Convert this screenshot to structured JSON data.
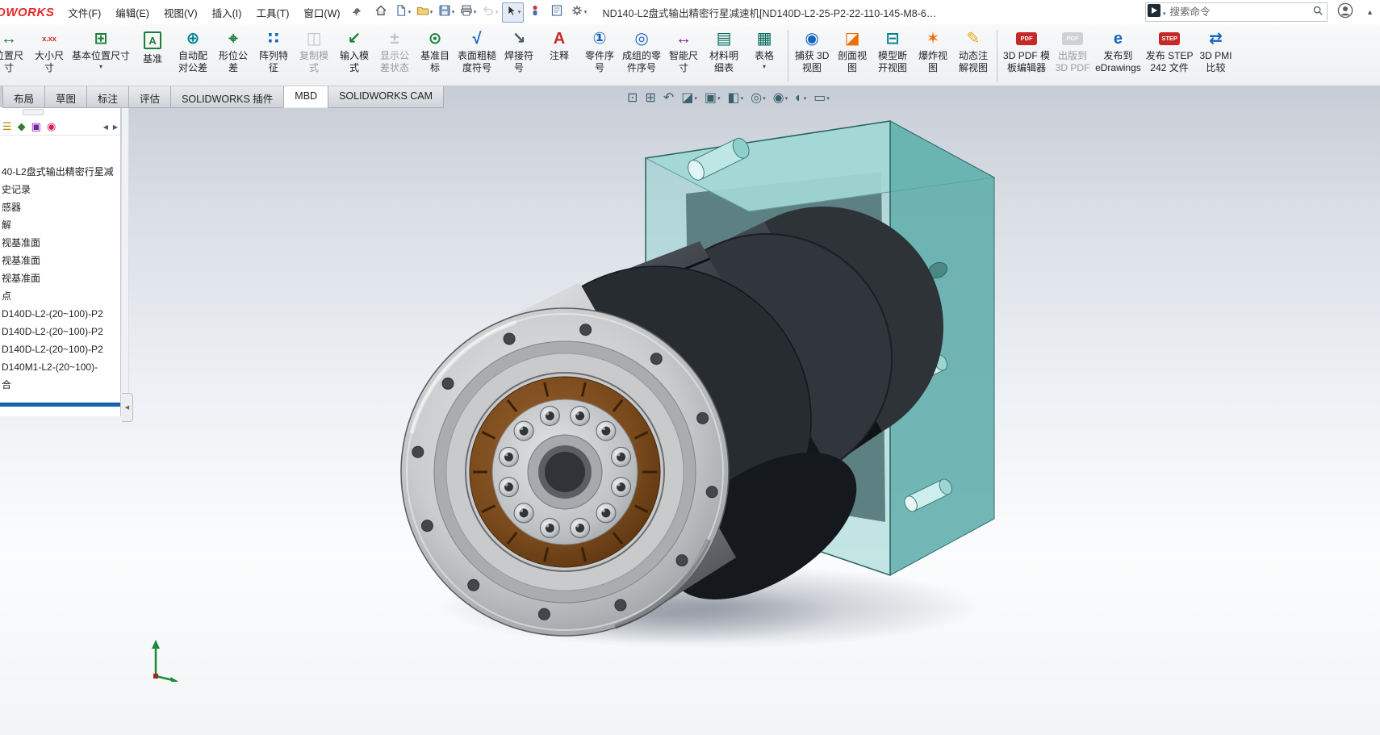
{
  "window": {
    "logo": "DWORKS",
    "title": "ND140-L2盘式输出精密行星减速机[ND140D-L2-25-P2-22-110-145-M8-6…"
  },
  "menubar": {
    "items": [
      "文件(F)",
      "编辑(E)",
      "视图(V)",
      "插入(I)",
      "工具(T)",
      "窗口(W)"
    ]
  },
  "quickbar": [
    {
      "name": "home",
      "dd": false
    },
    {
      "name": "new-document",
      "dd": true
    },
    {
      "name": "open",
      "dd": true
    },
    {
      "name": "save",
      "dd": true
    },
    {
      "name": "print",
      "dd": true
    },
    {
      "name": "undo",
      "dd": true,
      "disabled": true
    },
    {
      "name": "select",
      "dd": true,
      "pressed": true
    },
    {
      "name": "rebuild",
      "dd": false
    },
    {
      "name": "file-properties",
      "dd": false
    },
    {
      "name": "options",
      "dd": true
    }
  ],
  "search": {
    "placeholder": "搜索命令"
  },
  "ribbon": {
    "buttons": [
      {
        "name": "position-dimension",
        "lines": [
          "位置尺",
          "寸"
        ],
        "icon": {
          "g": "↔",
          "c": "#1a7f37"
        }
      },
      {
        "name": "size-dimension",
        "lines": [
          "大小尺",
          "寸"
        ],
        "icon": {
          "g": "x.xx",
          "c": "#c62828"
        }
      },
      {
        "name": "basic-location-dimension",
        "lines": [
          "基本位置尺寸"
        ],
        "dd": true,
        "icon": {
          "g": "⊞",
          "c": "#1a7f37"
        }
      },
      {
        "name": "datum",
        "lines": [
          "基准"
        ],
        "icon": {
          "g": "A",
          "c": "#1a7f37",
          "box": true
        }
      },
      {
        "name": "auto-pair-tolerance",
        "lines": [
          "自动配",
          "对公差"
        ],
        "icon": {
          "g": "⊕",
          "c": "#00838f"
        }
      },
      {
        "name": "geometric-tolerance",
        "lines": [
          "形位公",
          "差"
        ],
        "icon": {
          "g": "⌖",
          "c": "#1a7f37"
        }
      },
      {
        "name": "pattern-feature",
        "lines": [
          "阵列特",
          "征"
        ],
        "icon": {
          "g": "∷",
          "c": "#1565c0"
        }
      },
      {
        "name": "copy-scheme",
        "lines": [
          "复制模",
          "式"
        ],
        "disabled": true,
        "icon": {
          "g": "◫",
          "c": "#7a8087"
        }
      },
      {
        "name": "import-scheme",
        "lines": [
          "输入模",
          "式"
        ],
        "icon": {
          "g": "↙",
          "c": "#1a7f37"
        }
      },
      {
        "name": "show-tolerance-status",
        "lines": [
          "显示公",
          "差状态"
        ],
        "disabled": true,
        "icon": {
          "g": "±",
          "c": "#7a8087"
        }
      },
      {
        "name": "datum-target",
        "lines": [
          "基准目",
          "标"
        ],
        "icon": {
          "g": "⊙",
          "c": "#1a7f37"
        }
      },
      {
        "name": "surface-finish",
        "lines": [
          "表面粗糙",
          "度符号"
        ],
        "icon": {
          "g": "√",
          "c": "#1565c0"
        }
      },
      {
        "name": "weld-symbol",
        "lines": [
          "焊接符",
          "号"
        ],
        "icon": {
          "g": "↘",
          "c": "#455a64"
        }
      },
      {
        "name": "note",
        "lines": [
          "注释"
        ],
        "icon": {
          "g": "A",
          "c": "#c62828"
        }
      },
      {
        "name": "balloon",
        "lines": [
          "零件序",
          "号"
        ],
        "icon": {
          "g": "①",
          "c": "#1565c0"
        }
      },
      {
        "name": "stacked-balloon",
        "lines": [
          "成组的零",
          "件序号"
        ],
        "icon": {
          "g": "◎",
          "c": "#1565c0"
        }
      },
      {
        "name": "smart-dimension",
        "lines": [
          "智能尺",
          "寸"
        ],
        "icon": {
          "g": "↔",
          "c": "#7b1fa2"
        }
      },
      {
        "name": "bill-of-materials",
        "lines": [
          "材料明",
          "细表"
        ],
        "icon": {
          "g": "▤",
          "c": "#00695c"
        }
      },
      {
        "name": "tables",
        "lines": [
          "表格"
        ],
        "dd": true,
        "icon": {
          "g": "▦",
          "c": "#00695c"
        }
      },
      {
        "name": "capture-3d-view",
        "sep": true,
        "lines": [
          "捕获 3D",
          "视图"
        ],
        "icon": {
          "g": "◉",
          "c": "#1565c0"
        }
      },
      {
        "name": "section-view-cmd",
        "lines": [
          "剖面视",
          "图"
        ],
        "icon": {
          "g": "◪",
          "c": "#ef6c00"
        }
      },
      {
        "name": "break-view",
        "lines": [
          "模型断",
          "开视图"
        ],
        "icon": {
          "g": "⊟",
          "c": "#00838f"
        }
      },
      {
        "name": "exploded-view",
        "lines": [
          "爆炸视",
          "图"
        ],
        "icon": {
          "g": "✶",
          "c": "#ef6c00"
        }
      },
      {
        "name": "dynamic-annotation-views",
        "lines": [
          "动态注",
          "解视图"
        ],
        "icon": {
          "g": "✎",
          "c": "#e6a817"
        }
      },
      {
        "name": "3d-pdf-template-editor",
        "sep": true,
        "lines": [
          "3D PDF 模",
          "板编辑器"
        ],
        "icon": {
          "g": "PDF",
          "c": "#ffffff",
          "bg": "#c62828"
        }
      },
      {
        "name": "publish-to-3d-pdf",
        "lines": [
          "出版到",
          "3D PDF"
        ],
        "disabled": true,
        "icon": {
          "g": "PDF",
          "c": "#ffffff",
          "bg": "#9aa0a5"
        }
      },
      {
        "name": "publish-edrawings",
        "lines": [
          "发布到",
          "eDrawings"
        ],
        "icon": {
          "g": "e",
          "c": "#1565c0"
        }
      },
      {
        "name": "publish-step-242",
        "lines": [
          "发布 STEP",
          "242 文件"
        ],
        "icon": {
          "g": "STEP",
          "c": "#ffffff",
          "bg": "#c62828"
        }
      },
      {
        "name": "3d-pmi-compare",
        "lines": [
          "3D PMI",
          "比较"
        ],
        "icon": {
          "g": "⇄",
          "c": "#1565c0"
        }
      }
    ]
  },
  "tabs": {
    "items": [
      {
        "label": "布局",
        "name": "tab-layout"
      },
      {
        "label": "草图",
        "name": "tab-sketch"
      },
      {
        "label": "标注",
        "name": "tab-annotation"
      },
      {
        "label": "评估",
        "name": "tab-evaluate"
      },
      {
        "label": "SOLIDWORKS 插件",
        "name": "tab-solidworks-addins"
      },
      {
        "label": "MBD",
        "name": "tab-mbd",
        "active": true
      },
      {
        "label": "SOLIDWORKS CAM",
        "name": "tab-solidworks-cam"
      }
    ]
  },
  "headsup": {
    "items": [
      {
        "name": "zoom-to-fit",
        "g": "⊡"
      },
      {
        "name": "zoom-to-area",
        "g": "⊞"
      },
      {
        "name": "previous-view",
        "g": "↶"
      },
      {
        "name": "section-view",
        "g": "◪",
        "dd": true
      },
      {
        "name": "view-orientation",
        "g": "▣",
        "dd": true
      },
      {
        "name": "display-style",
        "g": "◧",
        "dd": true
      },
      {
        "name": "hide-show-items",
        "g": "◎",
        "dd": true
      },
      {
        "name": "edit-appearance",
        "g": "◉",
        "dd": true
      },
      {
        "name": "apply-scene",
        "g": "◐",
        "dd": true
      },
      {
        "name": "view-settings",
        "g": "▭",
        "dd": true
      }
    ]
  },
  "panel": {
    "manager_tabs": [
      {
        "name": "featuremanager-tab",
        "g": "☰",
        "c": "#b58900"
      },
      {
        "name": "propertymanager-tab",
        "g": "◆",
        "c": "#2e7d32"
      },
      {
        "name": "configurationmanager-tab",
        "g": "▣",
        "c": "#7b1fa2"
      },
      {
        "name": "displaymanager-tab",
        "g": "◉",
        "c": "#d81b60"
      }
    ],
    "tree": [
      "40-L2盘式输出精密行星减",
      "史记录",
      "感器",
      "解",
      "视基准面",
      "视基准面",
      "视基准面",
      "点",
      "D140D-L2-(20~100)-P2",
      "D140D-L2-(20~100)-P2",
      "D140D-L2-(20~100)-P2",
      "D140M1-L2-(20~100)-",
      "合"
    ]
  },
  "colors": {
    "accent_teal_part": "#8fd0cd",
    "rollback_blue": "#1464b4",
    "logo_red": "#e8262a"
  }
}
